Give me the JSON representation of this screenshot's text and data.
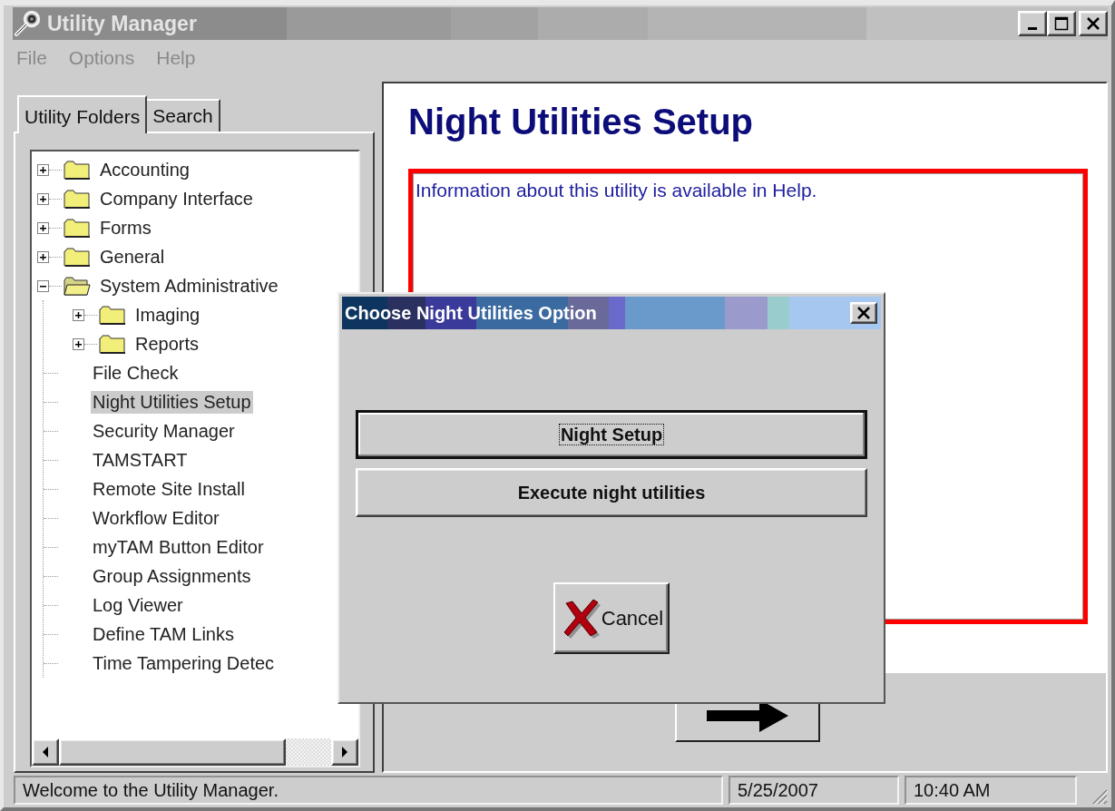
{
  "window": {
    "title": "Utility Manager",
    "active": false
  },
  "menu": [
    "File",
    "Options",
    "Help"
  ],
  "tabs": [
    {
      "label": "Utility Folders",
      "selected": true
    },
    {
      "label": "Search",
      "selected": false
    }
  ],
  "tree": [
    {
      "kind": "folder",
      "label": "Accounting",
      "expanded": false,
      "selected": false
    },
    {
      "kind": "folder",
      "label": "Company Interface",
      "expanded": false,
      "selected": false
    },
    {
      "kind": "folder",
      "label": "Forms",
      "expanded": false,
      "selected": false
    },
    {
      "kind": "folder",
      "label": "General",
      "expanded": false,
      "selected": false
    },
    {
      "kind": "folder",
      "label": "System Administrative",
      "expanded": true,
      "selected": false,
      "children": [
        {
          "kind": "folder",
          "label": "Imaging",
          "expanded": false,
          "selected": false
        },
        {
          "kind": "folder",
          "label": "Reports",
          "expanded": false,
          "selected": false
        },
        {
          "kind": "item",
          "label": "File Check",
          "selected": false
        },
        {
          "kind": "item",
          "label": "Night Utilities Setup",
          "selected": true
        },
        {
          "kind": "item",
          "label": "Security Manager",
          "selected": false
        },
        {
          "kind": "item",
          "label": "TAMSTART",
          "selected": false
        },
        {
          "kind": "item",
          "label": "Remote Site Install",
          "selected": false
        },
        {
          "kind": "item",
          "label": "Workflow Editor",
          "selected": false
        },
        {
          "kind": "item",
          "label": "myTAM Button Editor",
          "selected": false
        },
        {
          "kind": "item",
          "label": "Group Assignments",
          "selected": false
        },
        {
          "kind": "item",
          "label": "Log Viewer",
          "selected": false
        },
        {
          "kind": "item",
          "label": "Define TAM Links",
          "selected": false
        },
        {
          "kind": "item",
          "label": "Time Tampering Detec",
          "selected": false
        }
      ]
    }
  ],
  "detail": {
    "heading": "Night Utilities Setup",
    "info": "Information about this utility is available in Help."
  },
  "dialog": {
    "title": "Choose Night Utilities Option",
    "buttons": [
      {
        "label": "Night Setup",
        "focused": true
      },
      {
        "label": "Execute night utilities",
        "focused": false
      }
    ],
    "cancel": "Cancel"
  },
  "status_bar": {
    "message": "Welcome to the Utility Manager.",
    "date": "5/25/2007",
    "time": "10:40 AM"
  }
}
